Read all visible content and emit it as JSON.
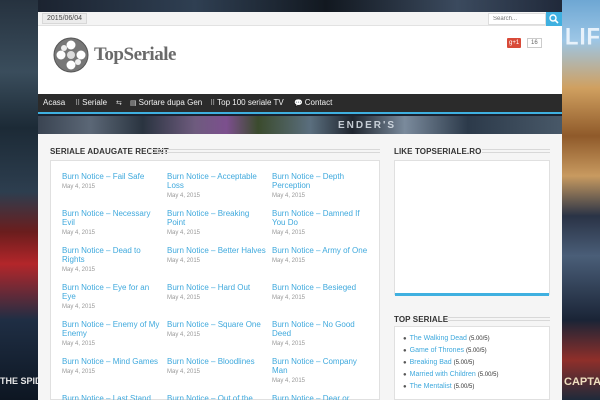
{
  "topbar": {
    "date": "2015/06/04",
    "search_placeholder": "Search..."
  },
  "header": {
    "logo_text": "TopSeriale",
    "gplus_label": "g+1",
    "gplus_count": "16"
  },
  "nav": {
    "items": [
      {
        "label": "Acasa",
        "icon": "none"
      },
      {
        "label": "Seriale",
        "icon": "grid-icon"
      },
      {
        "label": "",
        "icon": "shuffle-icon"
      },
      {
        "label": "Sortare dupa Gen",
        "icon": "list-icon"
      },
      {
        "label": "Top 100 seriale TV",
        "icon": "grid-icon"
      },
      {
        "label": "Contact",
        "icon": "chat-icon"
      }
    ]
  },
  "background": {
    "right_logo": "LIF",
    "left_text": "THE SPIDER",
    "right_text": "CAPTAIN",
    "banner_text": "ENDER'S"
  },
  "main": {
    "section_title": "SERIALE ADAUGATE RECENT",
    "posts": [
      {
        "title": "Burn Notice – Fail Safe",
        "date": "May 4, 2015"
      },
      {
        "title": "Burn Notice – Acceptable Loss",
        "date": "May 4, 2015"
      },
      {
        "title": "Burn Notice – Depth Perception",
        "date": "May 4, 2015"
      },
      {
        "title": "Burn Notice – Necessary Evil",
        "date": "May 4, 2015"
      },
      {
        "title": "Burn Notice – Breaking Point",
        "date": "May 4, 2015"
      },
      {
        "title": "Burn Notice – Damned If You Do",
        "date": "May 4, 2015"
      },
      {
        "title": "Burn Notice – Dead to Rights",
        "date": "May 4, 2015"
      },
      {
        "title": "Burn Notice – Better Halves",
        "date": "May 4, 2015"
      },
      {
        "title": "Burn Notice – Army of One",
        "date": "May 4, 2015"
      },
      {
        "title": "Burn Notice – Eye for an Eye",
        "date": "May 4, 2015"
      },
      {
        "title": "Burn Notice – Hard Out",
        "date": "May 4, 2015"
      },
      {
        "title": "Burn Notice – Besieged",
        "date": "May 4, 2015"
      },
      {
        "title": "Burn Notice – Enemy of My Enemy",
        "date": "May 4, 2015"
      },
      {
        "title": "Burn Notice – Square One",
        "date": "May 4, 2015"
      },
      {
        "title": "Burn Notice – No Good Deed",
        "date": "May 4, 2015"
      },
      {
        "title": "Burn Notice – Mind Games",
        "date": "May 4, 2015"
      },
      {
        "title": "Burn Notice – Bloodlines",
        "date": "May 4, 2015"
      },
      {
        "title": "Burn Notice – Company Man",
        "date": "May 4, 2015"
      },
      {
        "title": "Burn Notice – Last Stand",
        "date": ""
      },
      {
        "title": "Burn Notice – Out of the",
        "date": ""
      },
      {
        "title": "Burn Notice – Dear or",
        "date": ""
      }
    ]
  },
  "sidebar": {
    "like_title": "LIKE TOPSERIALE.RO",
    "top_title": "TOP SERIALE",
    "top_list": [
      {
        "name": "The Walking Dead",
        "score": "(5.00/5)"
      },
      {
        "name": "Game of Thrones",
        "score": "(5.00/5)"
      },
      {
        "name": "Breaking Bad",
        "score": "(5.00/5)"
      },
      {
        "name": "Married with Children",
        "score": "(5.00/5)"
      },
      {
        "name": "The Mentalist",
        "score": "(5.00/5)"
      }
    ]
  },
  "colors": {
    "accent": "#3fb0e0",
    "link": "#3fa9dd",
    "nav_bg": "#2b2b2b"
  }
}
